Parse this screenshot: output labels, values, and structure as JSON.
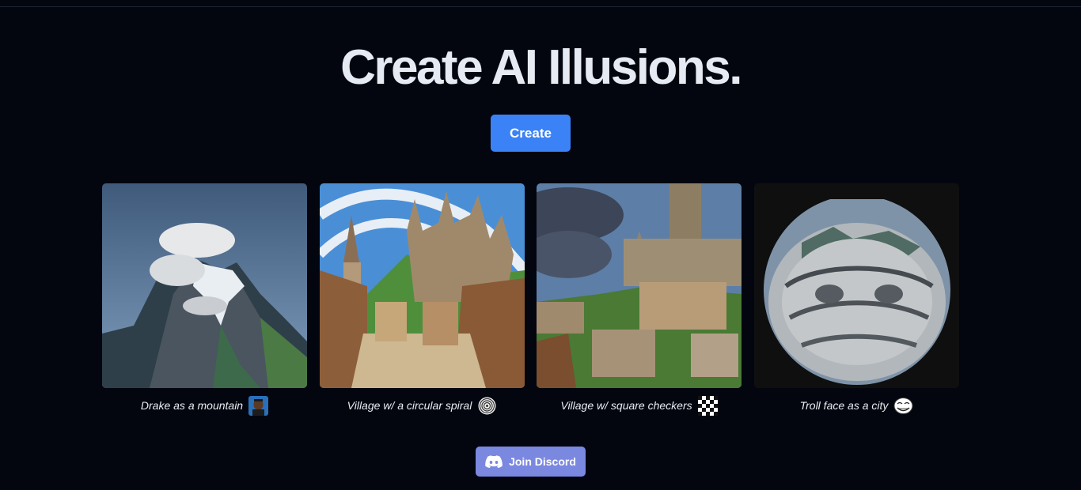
{
  "hero": {
    "title": "Create AI Illusions."
  },
  "actions": {
    "create_label": "Create",
    "discord_label": "Join Discord"
  },
  "gallery": {
    "items": [
      {
        "caption": "Drake as a mountain",
        "icon": "drake-face-icon"
      },
      {
        "caption": "Village w/ a circular spiral",
        "icon": "spiral-icon"
      },
      {
        "caption": "Village w/ square checkers",
        "icon": "checkerboard-icon"
      },
      {
        "caption": "Troll face as a city",
        "icon": "troll-face-icon"
      }
    ]
  },
  "colors": {
    "background": "#03060f",
    "create_button": "#3b82f6",
    "discord_button": "#7b88e0",
    "title": "#e6ebf3"
  }
}
